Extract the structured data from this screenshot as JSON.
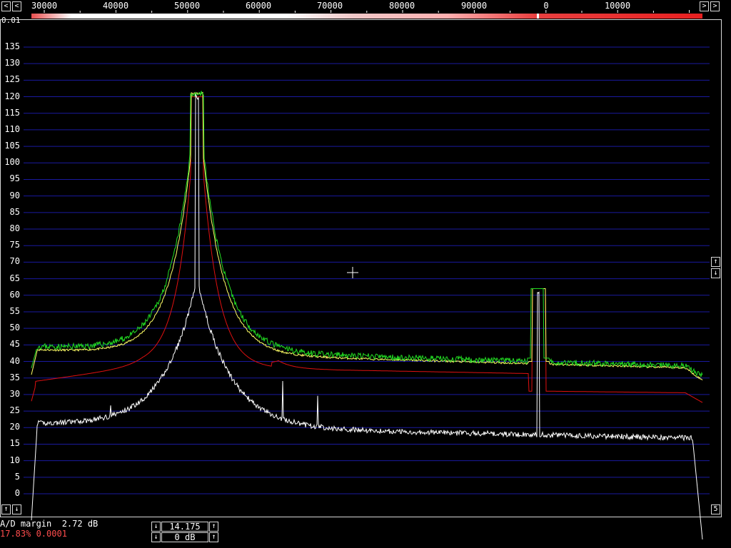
{
  "freq_scale": {
    "left_arrow": "<",
    "right_arrow": ">",
    "labels": [
      "30000",
      "40000",
      "50000",
      "60000",
      "70000",
      "80000",
      "90000",
      "0",
      "10000"
    ]
  },
  "corner_label": "0.01",
  "corner_box": "5",
  "spectrum": {
    "y_labels": [
      "135",
      "130",
      "125",
      "120",
      "115",
      "110",
      "105",
      "100",
      "95",
      "90",
      "85",
      "80",
      "75",
      "70",
      "65",
      "60",
      "55",
      "50",
      "45",
      "40",
      "35",
      "30",
      "25",
      "20",
      "15",
      "10",
      "5",
      "0"
    ],
    "gridline_color": "#1a1aa0",
    "trace_colors": {
      "green": "#22dd22",
      "yellow": "#ffff66",
      "red": "#e01010",
      "white": "#ffffff"
    }
  },
  "right_buttons": {
    "up": "↑",
    "down": "↓",
    "box": "5"
  },
  "left_buttons": {
    "up": "↑",
    "down": "↓"
  },
  "status": {
    "ad_margin": "A/D margin  2.72 dB",
    "percent": "17.83% 0.0001",
    "level_value": "14.175",
    "gain_value": "0 dB",
    "up_arrow": "↑",
    "down_arrow": "↓"
  },
  "chart_data": {
    "type": "line",
    "ylim": [
      0,
      135
    ],
    "series": [
      {
        "color": "#22dd22",
        "peak_x": 51500,
        "peak_y": 121,
        "floor_y": 41
      },
      {
        "color": "#ffff66",
        "peak_x": 51500,
        "peak_y": 121,
        "floor_y": 39
      },
      {
        "color": "#e01010",
        "peak_x": 51500,
        "peak_y": 120,
        "floor_y": 31
      },
      {
        "color": "#ffffff",
        "peak_x": 51500,
        "peak_y": 120,
        "floor_y": 18
      }
    ]
  }
}
